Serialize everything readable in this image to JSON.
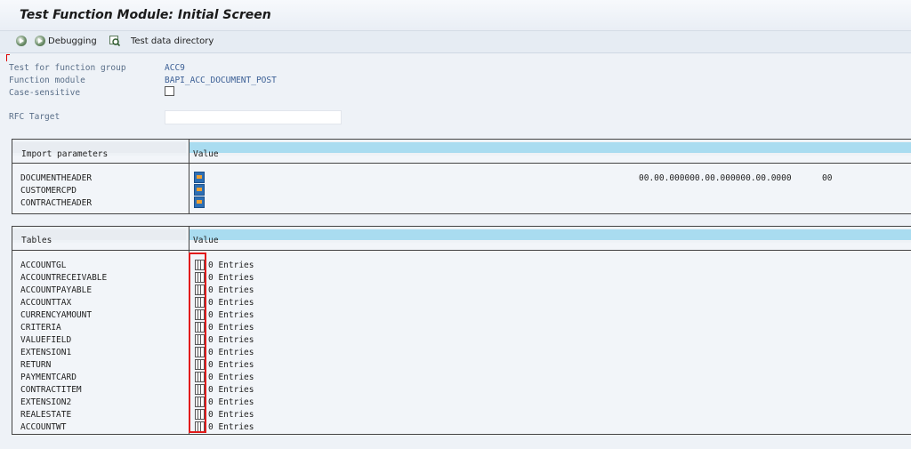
{
  "window": {
    "title": "Test Function Module: Initial Screen"
  },
  "toolbar": {
    "debugging_label": "Debugging",
    "test_data_label": "Test data directory"
  },
  "form": {
    "function_group_label": "Test for function group",
    "function_group_value": "ACC9",
    "function_module_label": "Function module",
    "function_module_value": "BAPI_ACC_DOCUMENT_POST",
    "case_sensitive_label": "Case-sensitive",
    "rfc_target_label": "RFC Target",
    "rfc_target_value": ""
  },
  "import_params": {
    "header_left": "Import parameters",
    "header_right": "Value",
    "rows": [
      "DOCUMENTHEADER",
      "CUSTOMERCPD",
      "CONTRACTHEADER"
    ],
    "documentheader_value": "00.00.000000.00.000000.00.0000",
    "documentheader_value2": "00"
  },
  "tables": {
    "header_left": "Tables",
    "header_right": "Value",
    "rows": [
      {
        "name": "ACCOUNTGL",
        "entries": "0 Entries"
      },
      {
        "name": "ACCOUNTRECEIVABLE",
        "entries": "0 Entries"
      },
      {
        "name": "ACCOUNTPAYABLE",
        "entries": "0 Entries"
      },
      {
        "name": "ACCOUNTTAX",
        "entries": "0 Entries"
      },
      {
        "name": "CURRENCYAMOUNT",
        "entries": "0 Entries"
      },
      {
        "name": "CRITERIA",
        "entries": "0 Entries"
      },
      {
        "name": "VALUEFIELD",
        "entries": "0 Entries"
      },
      {
        "name": "EXTENSION1",
        "entries": "0 Entries"
      },
      {
        "name": "RETURN",
        "entries": "0 Entries"
      },
      {
        "name": "PAYMENTCARD",
        "entries": "0 Entries"
      },
      {
        "name": "CONTRACTITEM",
        "entries": "0 Entries"
      },
      {
        "name": "EXTENSION2",
        "entries": "0 Entries"
      },
      {
        "name": "REALESTATE",
        "entries": "0 Entries"
      },
      {
        "name": "ACCOUNTWT",
        "entries": "0 Entries"
      }
    ]
  }
}
